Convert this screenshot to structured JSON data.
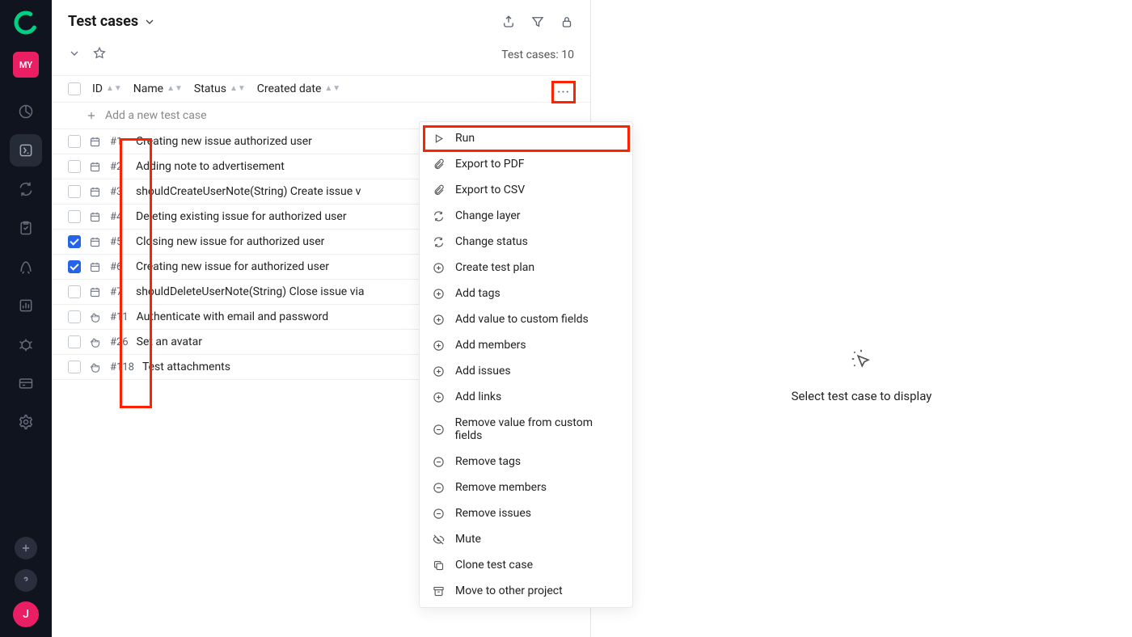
{
  "sidebar": {
    "project_badge": "MY",
    "avatar_letter": "J"
  },
  "header": {
    "title": "Test cases"
  },
  "meta": {
    "count_label": "Test cases: 10"
  },
  "columns": {
    "id": "ID",
    "name": "Name",
    "status": "Status",
    "created": "Created date"
  },
  "add_row": "Add a new test case",
  "rows": [
    {
      "id": "#1",
      "name": "Creating new issue authorized user",
      "type": "auto",
      "checked": false
    },
    {
      "id": "#2",
      "name": "Adding note to advertisement",
      "type": "auto",
      "checked": false
    },
    {
      "id": "#3",
      "name": "shouldCreateUserNote(String) Create issue v",
      "type": "auto",
      "checked": false
    },
    {
      "id": "#4",
      "name": "Deleting existing issue for authorized user",
      "type": "auto",
      "checked": false
    },
    {
      "id": "#5",
      "name": "Closing new issue for authorized user",
      "type": "auto",
      "checked": true
    },
    {
      "id": "#6",
      "name": "Creating new issue for authorized user",
      "type": "auto",
      "checked": true
    },
    {
      "id": "#7",
      "name": "shouldDeleteUserNote(String) Close issue via",
      "type": "auto",
      "checked": false
    },
    {
      "id": "#11",
      "name": "Authenticate with email and password",
      "type": "manual",
      "checked": false
    },
    {
      "id": "#26",
      "name": "Set an avatar",
      "type": "manual",
      "checked": false
    },
    {
      "id": "#118",
      "name": "Test attachments",
      "type": "manual",
      "checked": false
    }
  ],
  "menu": [
    {
      "icon": "play",
      "label": "Run"
    },
    {
      "icon": "clip",
      "label": "Export to PDF"
    },
    {
      "icon": "clip",
      "label": "Export to CSV"
    },
    {
      "icon": "refresh",
      "label": "Change layer"
    },
    {
      "icon": "refresh",
      "label": "Change status"
    },
    {
      "icon": "plus-c",
      "label": "Create test plan"
    },
    {
      "icon": "plus-c",
      "label": "Add tags"
    },
    {
      "icon": "plus-c",
      "label": "Add value to custom fields"
    },
    {
      "icon": "plus-c",
      "label": "Add members"
    },
    {
      "icon": "plus-c",
      "label": "Add issues"
    },
    {
      "icon": "plus-c",
      "label": "Add links"
    },
    {
      "icon": "minus-c",
      "label": "Remove value from custom fields"
    },
    {
      "icon": "minus-c",
      "label": "Remove tags"
    },
    {
      "icon": "minus-c",
      "label": "Remove members"
    },
    {
      "icon": "minus-c",
      "label": "Remove issues"
    },
    {
      "icon": "eye-off",
      "label": "Mute"
    },
    {
      "icon": "copy",
      "label": "Clone test case"
    },
    {
      "icon": "archive",
      "label": "Move to other project"
    }
  ],
  "detail": {
    "empty": "Select test case to display"
  }
}
